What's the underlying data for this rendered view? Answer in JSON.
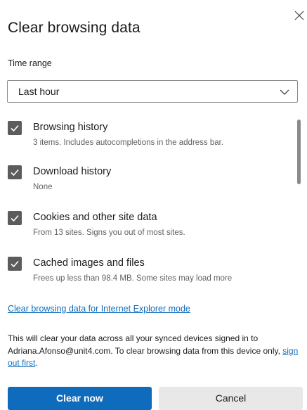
{
  "dialog": {
    "title": "Clear browsing data",
    "close_icon": "close-icon"
  },
  "time_range": {
    "label": "Time range",
    "selected": "Last hour",
    "icon": "chevron-down-icon"
  },
  "items": [
    {
      "title": "Browsing history",
      "description": "3 items. Includes autocompletions in the address bar.",
      "checked": true
    },
    {
      "title": "Download history",
      "description": "None",
      "checked": true
    },
    {
      "title": "Cookies and other site data",
      "description": "From 13 sites. Signs you out of most sites.",
      "checked": true
    },
    {
      "title": "Cached images and files",
      "description": "Frees up less than 98.4 MB. Some sites may load more",
      "checked": true
    }
  ],
  "ie_mode_link": "Clear browsing data for Internet Explorer mode",
  "sync_info": {
    "text": "This will clear your data across all your synced devices signed in to Adriana.Afonso@unit4.com. To clear browsing data from this device only, ",
    "link": "sign out first",
    "suffix": "."
  },
  "buttons": {
    "clear_now": "Clear now",
    "cancel": "Cancel"
  },
  "colors": {
    "accent": "#0f6cbd",
    "checkbox": "#5c5c5c",
    "secondary_button": "#e8e8e8"
  }
}
